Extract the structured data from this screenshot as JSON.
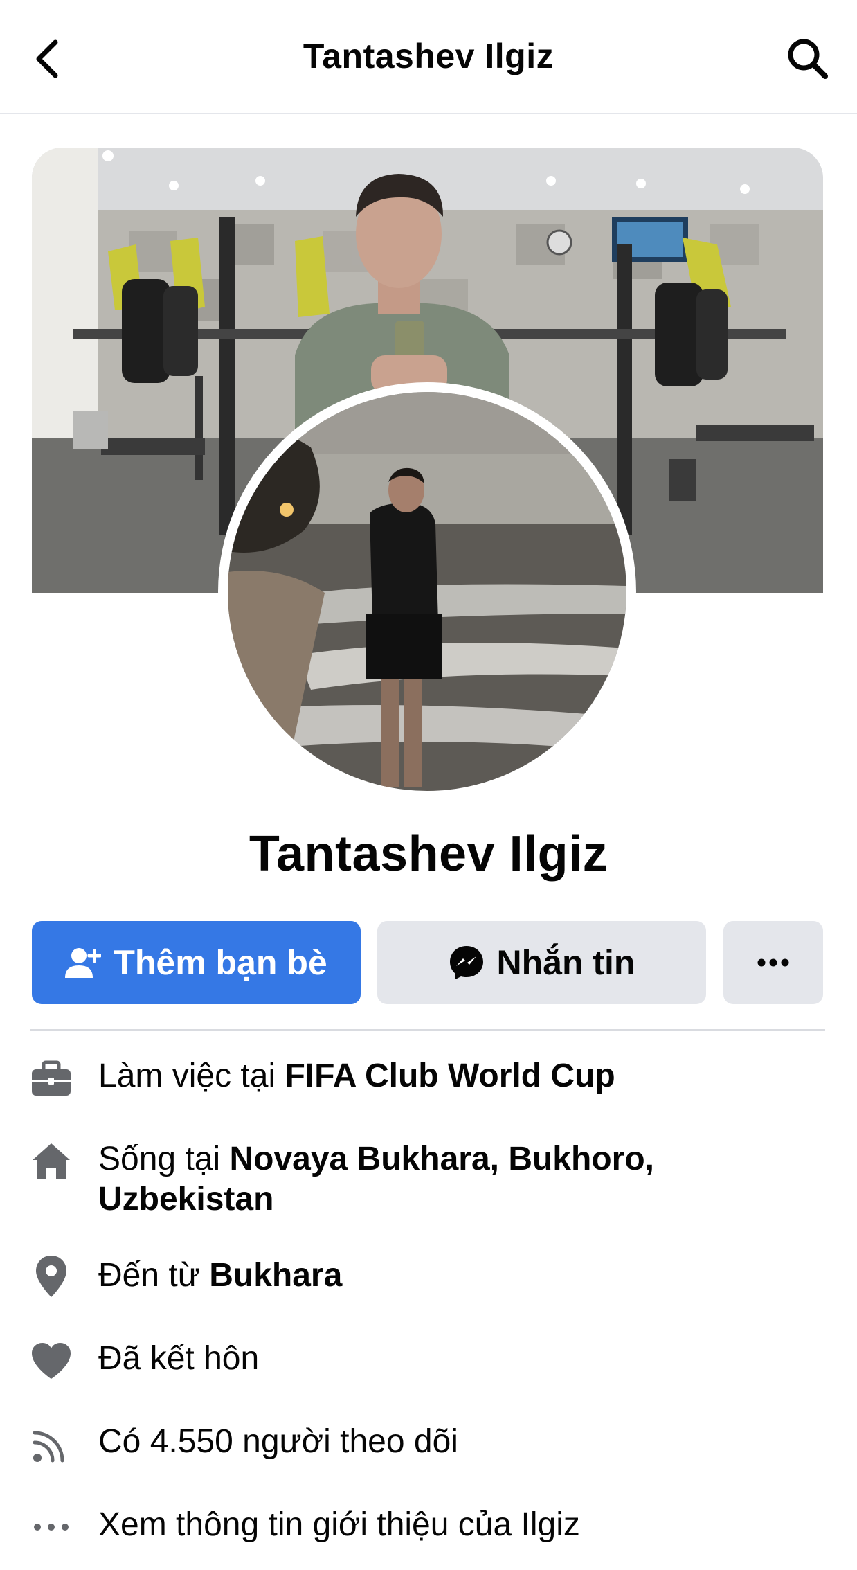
{
  "header": {
    "title": "Tantashev Ilgiz",
    "back_icon": "chevron-left-icon",
    "search_icon": "search-icon"
  },
  "profile": {
    "name": "Tantashev Ilgiz"
  },
  "actions": {
    "add_friend_label": "Thêm bạn bè",
    "message_label": "Nhắn tin",
    "more_icon": "more-dots-icon"
  },
  "intro": {
    "work_prefix": "Làm việc tại ",
    "work_place": "FIFA Club World Cup",
    "lives_prefix": "Sống tại ",
    "lives_place_line1": "Novaya Bukhara, Bukhoro,",
    "lives_place_line2": "Uzbekistan",
    "from_prefix": "Đến từ ",
    "from_place": "Bukhara",
    "relationship": "Đã kết hôn",
    "followers": "Có 4.550 người theo dõi",
    "see_about": "Xem thông tin giới thiệu của Ilgiz"
  },
  "colors": {
    "accent": "#3578e5",
    "secondary_button": "#e4e6eb",
    "icon_gray": "#65676b",
    "text": "#050505"
  }
}
